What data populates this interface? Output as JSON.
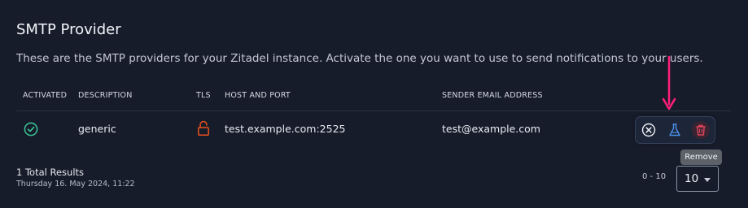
{
  "section": {
    "title": "SMTP Provider",
    "description": "These are the SMTP providers for your Zitadel instance. Activate the one you want to use to send notifications to your users."
  },
  "table": {
    "columns": [
      "ACTIVATED",
      "DESCRIPTION",
      "TLS",
      "HOST AND PORT",
      "SENDER EMAIL ADDRESS"
    ],
    "rows": [
      {
        "activated": "check-circle-icon",
        "description": "generic",
        "tls": "unlocked-padlock-icon",
        "host_port": "test.example.com:2525",
        "sender_email": "test@example.com"
      }
    ]
  },
  "row_actions": {
    "icons": [
      "deactivate-x-circle-icon",
      "test-flask-icon",
      "trash-icon"
    ],
    "tooltip": "Remove"
  },
  "footer": {
    "total": "1 Total Results",
    "timestamp": "Thursday 16. May 2024, 11:22",
    "range": "0 - 10",
    "page_size": "10"
  },
  "colors": {
    "background": "#171c2b",
    "check": "#38c796",
    "tls_icon": "#e8511b",
    "flask": "#4a8fe7",
    "trash": "#e0455c",
    "annotation_arrow": "#ff1f7a"
  }
}
